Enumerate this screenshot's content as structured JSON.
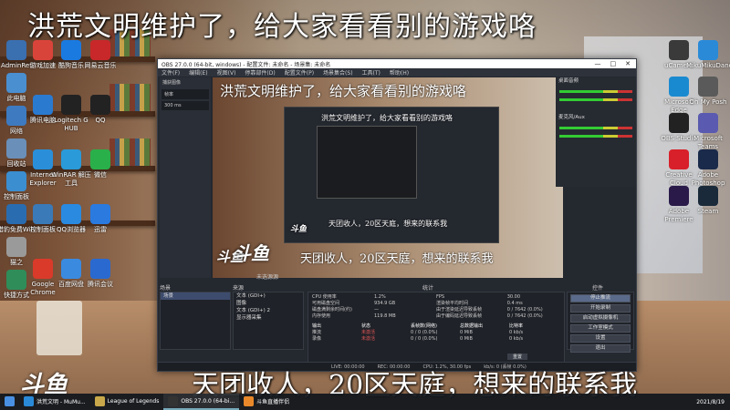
{
  "overlay": {
    "top_caption": "洪荒文明维护了，给大家看看别的游戏咯",
    "bottom_caption": "天团收人，20区天庭，想来的联系我",
    "logo": "斗鱼"
  },
  "desktop_left": [
    {
      "label": "AdminRet",
      "icon": "admin-icon",
      "color": "#3a6fb0"
    },
    {
      "label": "此电脑",
      "icon": "computer-icon",
      "color": "#4a8fd0"
    },
    {
      "label": "网络",
      "icon": "network-icon",
      "color": "#3d7ac0"
    },
    {
      "label": "回收站",
      "icon": "recycle-bin-icon",
      "color": "#6a8fb8"
    },
    {
      "label": "控制面板",
      "icon": "control-panel-icon",
      "color": "#3b8ed0"
    },
    {
      "label": "猎豹免费WiFi",
      "icon": "wifi-icon",
      "color": "#2a6cb0"
    },
    {
      "label": "猫之",
      "icon": "cat-icon",
      "color": "#9a9a9a"
    },
    {
      "label": "快捷方式",
      "icon": "shortcut-icon",
      "color": "#2f8d5a"
    }
  ],
  "desktop_col2": [
    {
      "label": "游戏加速",
      "icon": "game-boost-icon",
      "color": "#d9443a"
    },
    {
      "label": "腾讯电脑",
      "icon": "pc-manager-icon",
      "color": "#2a7ad0"
    },
    {
      "label": "Internet Explorer",
      "icon": "ie-icon",
      "color": "#2a8fd8"
    },
    {
      "label": "控制面板",
      "icon": "panel-icon",
      "color": "#3a7ab8"
    },
    {
      "label": "Google Chrome",
      "icon": "chrome-icon",
      "color": "#d93a2a"
    }
  ],
  "desktop_col3": [
    {
      "label": "酷狗音乐",
      "icon": "kugou-icon",
      "color": "#1a7ae0"
    },
    {
      "label": "Logitech G HUB",
      "icon": "ghub-icon",
      "color": "#222"
    },
    {
      "label": "WinRAR 解压工具",
      "icon": "rar-icon",
      "color": "#2a9ad8"
    },
    {
      "label": "QQ浏览器",
      "icon": "qq-browser-icon",
      "color": "#2a8ae0"
    },
    {
      "label": "百度网盘",
      "icon": "baidu-icon",
      "color": "#3a8ae0"
    }
  ],
  "desktop_col4": [
    {
      "label": "网易云音乐",
      "icon": "netease-music-icon",
      "color": "#c8282a"
    },
    {
      "label": "QQ",
      "icon": "qq-icon",
      "color": "#222"
    },
    {
      "label": "微信",
      "icon": "wechat-icon",
      "color": "#2ab04a"
    },
    {
      "label": "迅雷",
      "icon": "thunder-icon",
      "color": "#2a7ae0"
    },
    {
      "label": "腾讯会议",
      "icon": "meeting-icon",
      "color": "#2a6ad0"
    }
  ],
  "desktop_right": [
    {
      "label": "uCamera",
      "icon": "camera-icon",
      "color": "#3a3a3a"
    },
    {
      "label": "Microsoft Edge",
      "icon": "edge-icon",
      "color": "#1a8ad0"
    },
    {
      "label": "OBS Studio",
      "icon": "obs-icon",
      "color": "#222"
    },
    {
      "label": "Creative Cloud",
      "icon": "creative-cloud-icon",
      "color": "#d8202a"
    },
    {
      "label": "Adobe Premiere",
      "icon": "premiere-icon",
      "color": "#2a1a4a"
    }
  ],
  "desktop_right2": [
    {
      "label": "MikuMikuDance",
      "icon": "mmd-icon",
      "color": "#2a8ad8"
    },
    {
      "label": "Oh My Posh",
      "icon": "posh-icon",
      "color": "#5a5a5a"
    },
    {
      "label": "Microsoft Teams",
      "icon": "teams-icon",
      "color": "#5a5ab0"
    },
    {
      "label": "Adobe Photoshop",
      "icon": "photoshop-icon",
      "color": "#1a2a4a"
    },
    {
      "label": "Steam",
      "icon": "steam-icon",
      "color": "#1a2a3a"
    }
  ],
  "obs": {
    "title": "OBS 27.0.0 (64-bit, windows) - 配置文件: 未命名 - 场景集: 未命名",
    "menu": [
      "文件(F)",
      "编辑(E)",
      "视图(V)",
      "停靠部件(D)",
      "配置文件(P)",
      "场景集合(S)",
      "工具(T)",
      "帮助(H)"
    ],
    "window_buttons": [
      "—",
      "□",
      "✕"
    ],
    "left_panel": {
      "title": "捕获图像",
      "field1": "帧率",
      "field2": "300 ms"
    },
    "preview": {
      "source_label": "未选源源"
    },
    "docks": {
      "scenes": "场景",
      "sources": "来源",
      "mixer": "统计",
      "controls": "控件"
    },
    "scenes": [
      "场景"
    ],
    "sources": [
      "文本 (GDI+)",
      "图像",
      "文本 (GDI+) 2",
      "显示器采集"
    ],
    "stats": {
      "rows": [
        [
          "CPU 使用率",
          "1.2%",
          "FPS",
          "30.00"
        ],
        [
          "可用磁盘空间",
          "934.9 GB",
          "渲染帧平均时间",
          "0.4 ms"
        ],
        [
          "磁盘满剩余时间(约)",
          "—",
          "由于渲染延迟导致丢帧",
          "0 / 7642 (0.0%)"
        ],
        [
          "内存使用",
          "119.8 MB",
          "由于编码延迟导致丢帧",
          "0 / 7642 (0.0%)"
        ]
      ],
      "table_header": [
        "输出",
        "状态",
        "丢帧数(网络)",
        "总数据输出",
        "比特率"
      ],
      "table_rows": [
        [
          "推流",
          "未激活",
          "0 / 0 (0.0%)",
          "0 MiB",
          "0 kb/s"
        ],
        [
          "录像",
          "未激活",
          "0 / 0 (0.0%)",
          "0 MiB",
          "0 kb/s"
        ]
      ],
      "reset_label": "重置"
    },
    "controls": [
      "停止推流",
      "开始录制",
      "启动虚拟摄像机",
      "工作室模式",
      "设置",
      "退出"
    ],
    "audio": [
      "桌面音频",
      "麦克风/Aux"
    ],
    "statusbar": {
      "live": "LIVE: 00:00:00",
      "rec": "REC: 00:00:00",
      "cpu": "CPU: 1.2%, 30.00 fps",
      "kb": "kb/s: 0 (丢帧 0.0%)"
    }
  },
  "taskbar": {
    "items": [
      {
        "label": "洪荒文明 - MuMu...",
        "icon": "mumu-icon",
        "color": "#2a8ad8",
        "active": false
      },
      {
        "label": "League of Legends",
        "icon": "lol-icon",
        "color": "#c8a84a",
        "active": false
      },
      {
        "label": "OBS 27.0.0 (64-bi...",
        "icon": "obs-taskbar-icon",
        "color": "#333",
        "active": true
      },
      {
        "label": "斗鱼直播伴侣",
        "icon": "douyu-icon",
        "color": "#e8882a",
        "active": false
      }
    ],
    "time": "2021/8/19"
  }
}
